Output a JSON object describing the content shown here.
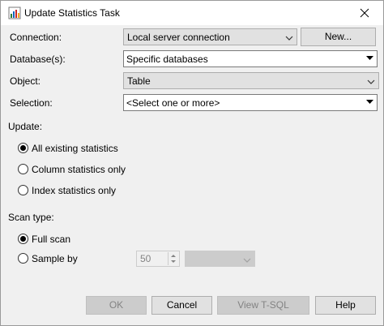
{
  "window": {
    "title": "Update Statistics Task"
  },
  "form": {
    "connection": {
      "label": "Connection:",
      "value": "Local server connection",
      "new_button": "New..."
    },
    "databases": {
      "label": "Database(s):",
      "value": "Specific databases"
    },
    "object": {
      "label": "Object:",
      "value": "Table"
    },
    "selection": {
      "label": "Selection:",
      "value": "<Select one or more>"
    }
  },
  "update": {
    "label": "Update:",
    "options": [
      {
        "label": "All existing statistics",
        "checked": true
      },
      {
        "label": "Column statistics only",
        "checked": false
      },
      {
        "label": "Index statistics only",
        "checked": false
      }
    ]
  },
  "scan": {
    "label": "Scan type:",
    "options": [
      {
        "label": "Full scan",
        "checked": true
      },
      {
        "label": "Sample by",
        "checked": false
      }
    ],
    "sample_value": "50"
  },
  "buttons": {
    "ok": "OK",
    "cancel": "Cancel",
    "view_tsql": "View T-SQL",
    "help": "Help"
  },
  "icons": {
    "app": "bar-chart-icon",
    "close": "close-icon",
    "dropdown": "chevron-down-icon"
  },
  "colors": {
    "dialog_bg": "#f0f0f0",
    "button_bg": "#e1e1e1",
    "disabled_text": "#838383"
  }
}
